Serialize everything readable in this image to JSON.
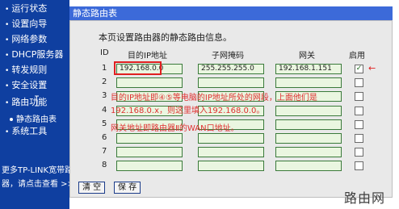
{
  "sidebar": {
    "items": [
      {
        "label": "运行状态"
      },
      {
        "label": "设置向导"
      },
      {
        "label": "网络参数"
      },
      {
        "label": "DHCP服务器"
      },
      {
        "label": "转发规则"
      },
      {
        "label": "安全设置"
      },
      {
        "label": "路由功能"
      }
    ],
    "sub_item": "静态路由表",
    "last_item": "系统工具",
    "promo_line1": "更多TP-LINK宽带路",
    "promo_line2": "器，请点击查看 >>"
  },
  "page": {
    "title": "静态路由表",
    "intro": "本页设置路由器的静态路由信息。"
  },
  "table": {
    "headers": {
      "id": "ID",
      "dest": "目的IP地址",
      "mask": "子网掩码",
      "gateway": "网关",
      "enable": "启用"
    },
    "rows": [
      {
        "id": "1",
        "dest": "192.168.0.0",
        "mask": "255.255.255.0",
        "gateway": "192.168.1.151",
        "enabled": "✓"
      },
      {
        "id": "2",
        "dest": "",
        "mask": "",
        "gateway": "",
        "enabled": ""
      },
      {
        "id": "3",
        "dest": "",
        "mask": "",
        "gateway": "",
        "enabled": ""
      },
      {
        "id": "4",
        "dest": "",
        "mask": "",
        "gateway": "",
        "enabled": ""
      },
      {
        "id": "5",
        "dest": "",
        "mask": "",
        "gateway": "",
        "enabled": ""
      },
      {
        "id": "6",
        "dest": "",
        "mask": "",
        "gateway": "",
        "enabled": ""
      },
      {
        "id": "7",
        "dest": "",
        "mask": "",
        "gateway": "",
        "enabled": ""
      },
      {
        "id": "8",
        "dest": "",
        "mask": "",
        "gateway": "",
        "enabled": ""
      }
    ]
  },
  "annotation": {
    "arrow": "←",
    "line1": "目的IP地址即④⑤等电脑的IP地址所处的网段，上面他们是",
    "line2": "192.168.0.x，则这里填入192.168.0.0。",
    "line3": "网关地址即路由器Ⅱ的WAN口地址。"
  },
  "buttons": {
    "clear": "清 空",
    "save": "保 存"
  },
  "watermark": "路由网"
}
